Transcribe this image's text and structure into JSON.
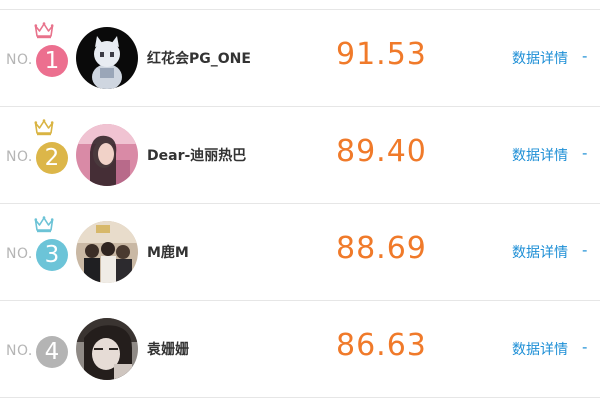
{
  "ranking": {
    "rows": [
      {
        "no_label": "NO.",
        "rank": "1",
        "name": "红花会PG_ONE",
        "score": "91.53",
        "detail_label": "数据详情",
        "dash": "-",
        "crown_color": "#e8738c",
        "badge_color": "#ec6f8f",
        "crown_icon": "crown-icon",
        "avatar_icon": "avatar-image"
      },
      {
        "no_label": "NO.",
        "rank": "2",
        "name": "Dear-迪丽热巴",
        "score": "89.40",
        "detail_label": "数据详情",
        "dash": "-",
        "crown_color": "#d9b443",
        "badge_color": "#dcb649",
        "crown_icon": "crown-icon",
        "avatar_icon": "avatar-image"
      },
      {
        "no_label": "NO.",
        "rank": "3",
        "name": "M鹿M",
        "score": "88.69",
        "detail_label": "数据详情",
        "dash": "-",
        "crown_color": "#6cc3d6",
        "badge_color": "#6cc4d8",
        "crown_icon": "crown-icon",
        "avatar_icon": "avatar-image"
      },
      {
        "no_label": "NO.",
        "rank": "4",
        "name": "袁姗姗",
        "score": "86.63",
        "detail_label": "数据详情",
        "dash": "-",
        "crown_color": null,
        "badge_color": "#b4b4b4",
        "crown_icon": null,
        "avatar_icon": "avatar-image"
      }
    ],
    "colors": {
      "score": "#f07a2a",
      "link": "#1e8fd6",
      "divider": "#e6e6e6",
      "muted": "#b5b5b5"
    }
  }
}
